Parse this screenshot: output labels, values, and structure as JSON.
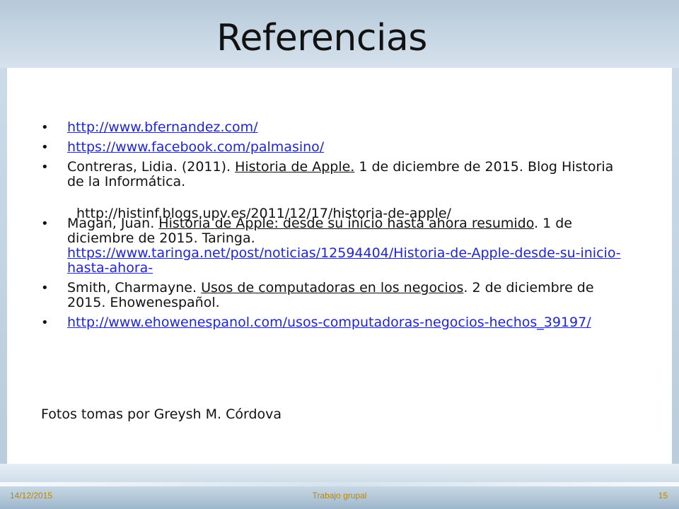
{
  "slide": {
    "title": "Referencias",
    "references": [
      {
        "link": "http://www.bfernandez.com/"
      },
      {
        "link": "https://www.facebook.com/palmasino/"
      },
      {
        "prefix": "Contreras, Lidia. (2011). ",
        "italic_title": "Historia de Apple.",
        "suffix": " 1 de diciembre de 2015. Blog Historia de la Informática."
      },
      {
        "prefix": "Magan, Juan. ",
        "italic_title": "Historia de Apple: desde su inicio hasta ahora resumido",
        "suffix": ". 1 de diciembre de 2015. Taringa. ",
        "link": "https://www.taringa.net/post/noticias/12594404/Historia-de-Apple-desde-su-inicio-hasta-ahora-"
      },
      {
        "prefix": "Smith, Charmayne.  ",
        "italic_title": "Usos de computadoras en los negocios",
        "suffix": ". 2 de diciembre de 2015. Ehowenespañol."
      },
      {
        "link": "http://www.ehowenespanol.com/usos-computadoras-negocios-hechos_39197/"
      }
    ],
    "indent_url": "http://histinf.blogs.upv.es/2011/12/17/historia-de-apple/",
    "photos_credit": "Fotos tomas por Greysh M. Córdova"
  },
  "footer": {
    "date": "14/12/2015",
    "center": "Trabajo grupal",
    "page": "15"
  },
  "colors": {
    "link": "#1f25d6",
    "footer_text": "#b8860b",
    "background": "#b7cbdc"
  }
}
